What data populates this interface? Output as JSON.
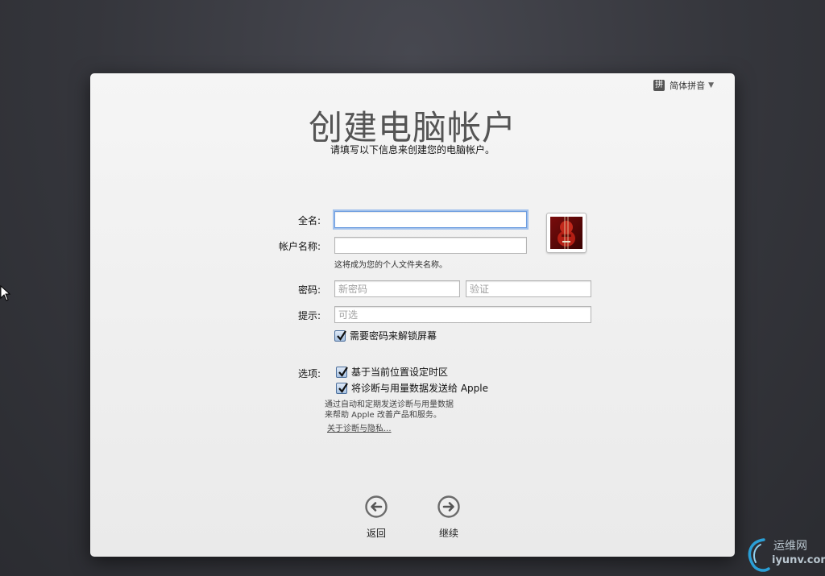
{
  "input_method": {
    "badge": "拼",
    "label": "简体拼音"
  },
  "header": {
    "title": "创建电脑帐户",
    "subtitle": "请填写以下信息来创建您的电脑帐户。"
  },
  "form": {
    "full_name": {
      "label": "全名:",
      "value": ""
    },
    "account_name": {
      "label": "帐户名称:",
      "value": "",
      "hint": "这将成为您的个人文件夹名称。"
    },
    "password": {
      "label": "密码:",
      "placeholder": "新密码",
      "verify_placeholder": "验证"
    },
    "hint": {
      "label": "提示:",
      "placeholder": "可选"
    },
    "require_password_unlock": {
      "label": "需要密码来解锁屏幕",
      "checked": true
    }
  },
  "options": {
    "label": "选项:",
    "set_timezone": {
      "label": "基于当前位置设定时区",
      "checked": true
    },
    "send_diagnostics": {
      "label": "将诊断与用量数据发送给 Apple",
      "checked": true
    },
    "description_line1": "通过自动和定期发送诊断与用量数据",
    "description_line2": "来帮助 Apple 改善产品和服务。",
    "about_link": "关于诊断与隐私..."
  },
  "navigation": {
    "back_label": "返回",
    "continue_label": "继续"
  },
  "watermark": {
    "cn": "运维网",
    "en": "iyunv.com"
  },
  "colors": {
    "accent": "#6f9ee0",
    "panel": "#f0f0f0",
    "desktop": "#35363c"
  }
}
